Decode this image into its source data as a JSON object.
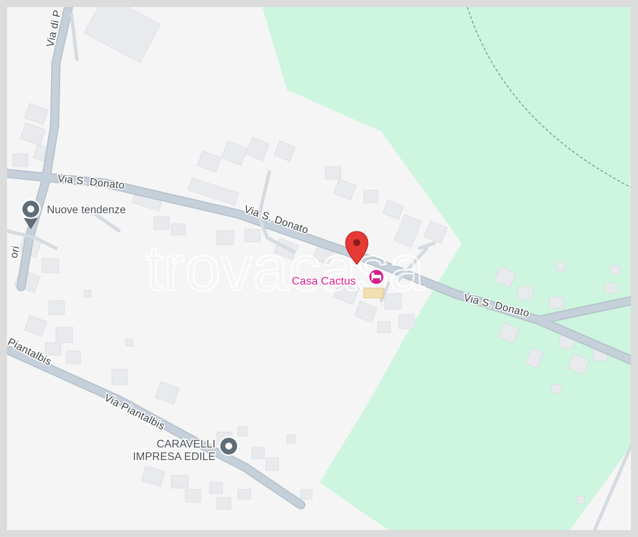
{
  "map": {
    "colors": {
      "background": "#f5f5f5",
      "park": "#cdf5df",
      "road": "#c6d0da",
      "road_edge": "#b3bfca",
      "building": "#e8eaed",
      "pin": "#e53935",
      "hotel": "#d61f8c",
      "poi": "#5f6d78"
    },
    "roads": {
      "via_san_donato_left": "Via S. Donato",
      "via_san_donato_center": "Via S. Donato",
      "via_san_donato_right": "Via S. Donato",
      "via_piantalbis": "Via Piantalbis",
      "piantalbis_partial": "Piantalbis",
      "via_di_top_partial": "Via di P",
      "ori_partial": "ori"
    },
    "pois": {
      "nuove_tendenze": "Nuove tendenze",
      "caravelli_line1": "CARAVELLI",
      "caravelli_line2": "IMPRESA EDILE",
      "casa_cactus": "Casa Cactus"
    },
    "icons": {
      "location_pin": "location-pin-icon",
      "poi_marker": "poi-marker-icon",
      "hotel": "hotel-icon"
    },
    "watermark": "trovacasa"
  }
}
